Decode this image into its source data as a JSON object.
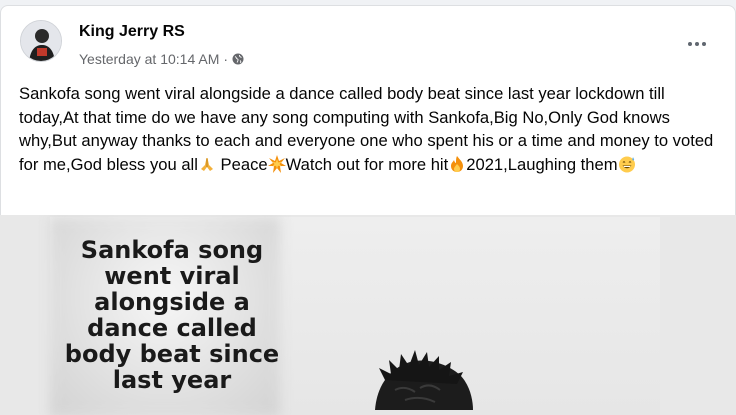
{
  "post": {
    "author": "King Jerry RS",
    "timestamp": "Yesterday at 10:14 AM",
    "separator": "·",
    "text_parts": {
      "main": "Sankofa song went viral alongside a dance called body beat since last year lockdown till today,At that time do we have any song computing  with Sankofa,Big No,Only God knows why,But anyway thanks to each and everyone one who spent his or a time and money to voted for me,God bless you all",
      "after_pray": " Peace",
      "after_boom": "Watch out for more hit",
      "after_fire": "2021,Laughing them"
    },
    "emojis": [
      "pray-emoji",
      "collision-emoji",
      "fire-emoji",
      "grinning-sweat-emoji"
    ]
  },
  "image": {
    "overlay_text": "Sankofa song\nwent viral\nalongside a\ndance called\nbody beat since\nlast year"
  },
  "icons": {
    "audience": "globe-icon",
    "menu": "more-options-icon"
  },
  "colors": {
    "name": "#050505",
    "meta": "#65676b",
    "background": "#f0f2f5"
  }
}
